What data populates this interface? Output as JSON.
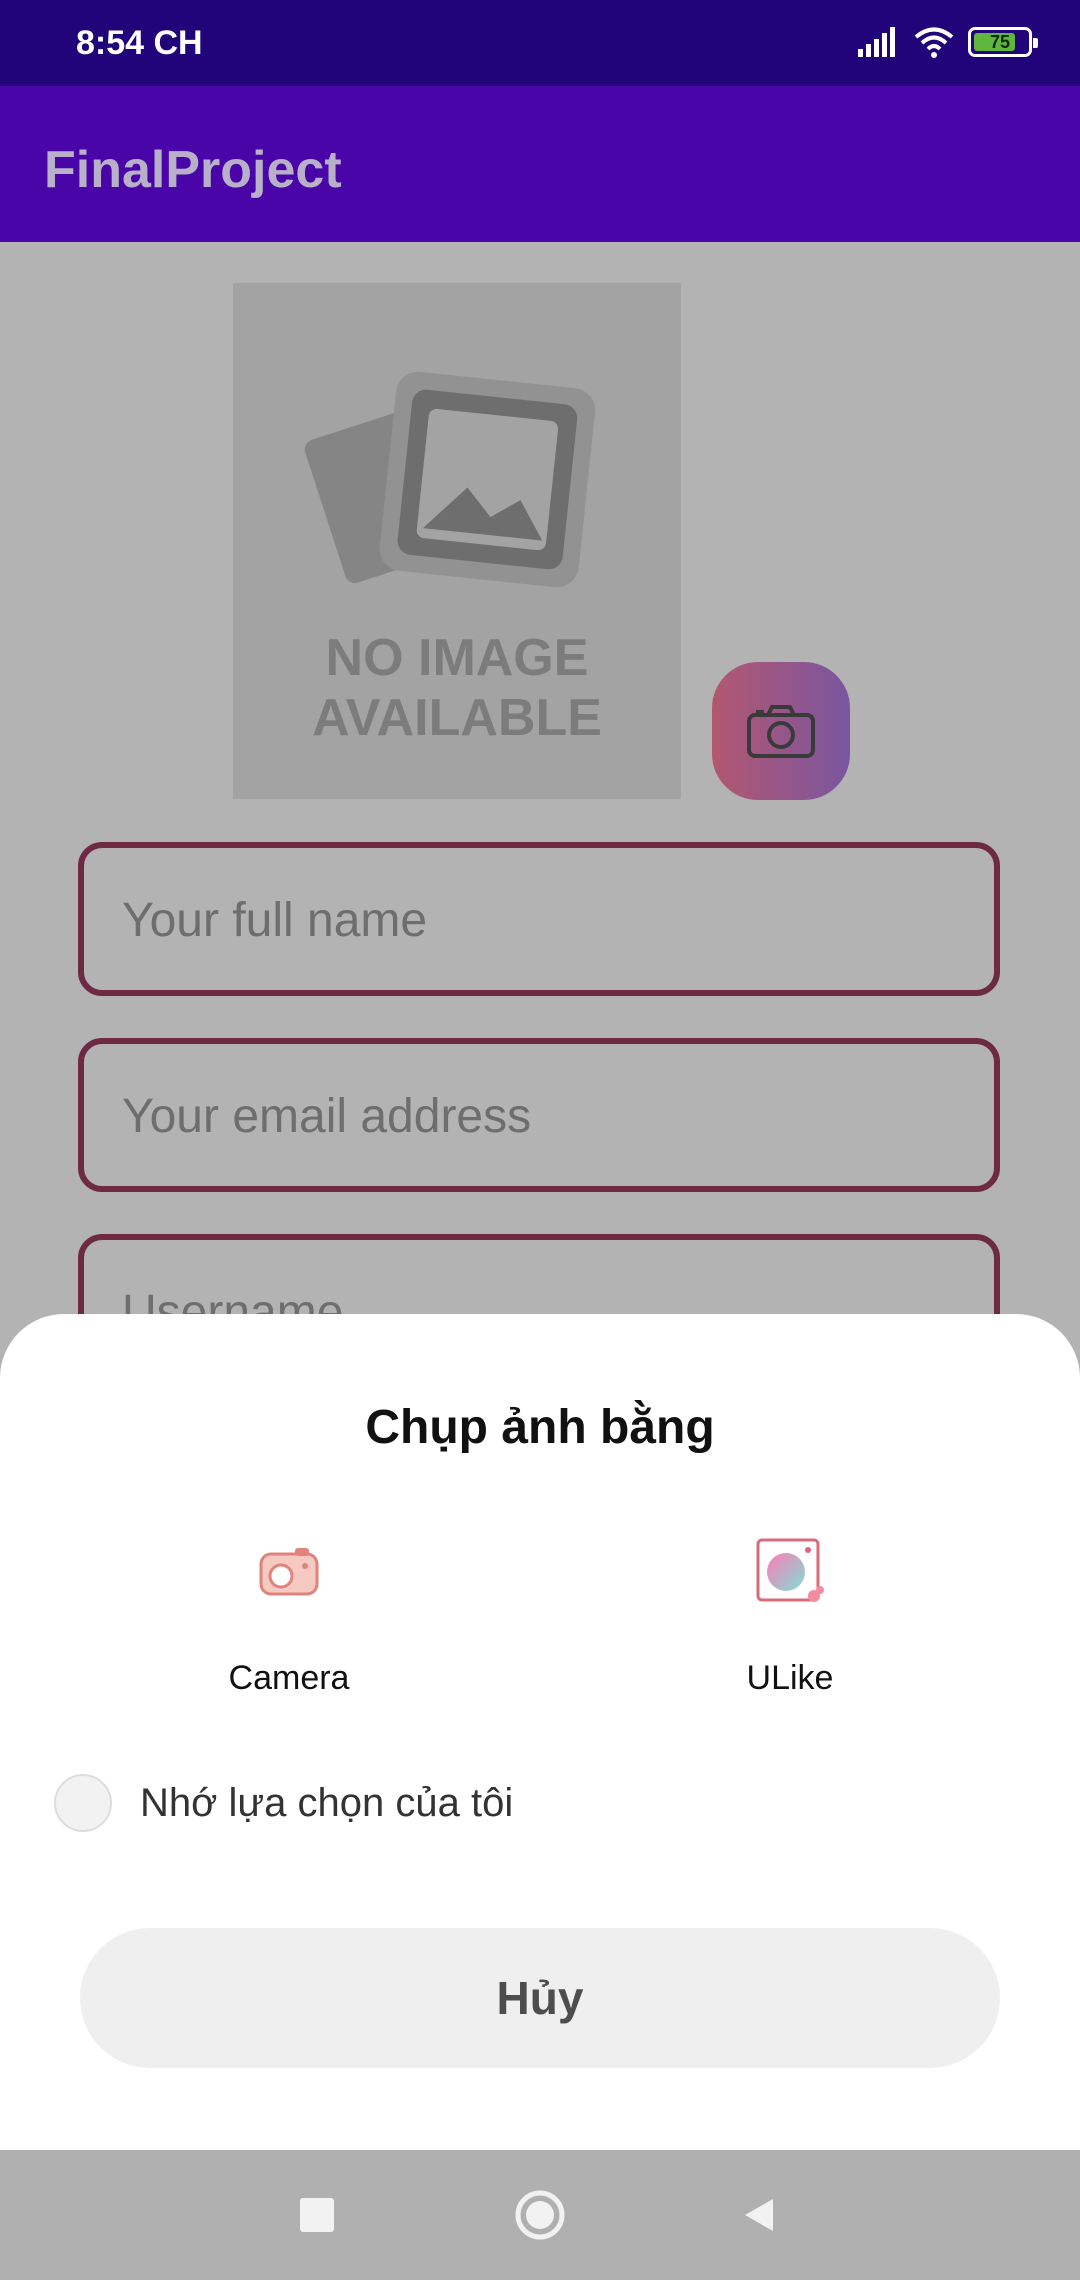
{
  "status_bar": {
    "time": "8:54 CH",
    "battery_level": "75",
    "icons": [
      "signal-icon",
      "wifi-icon",
      "battery-icon"
    ],
    "background": "#22047a"
  },
  "app_bar": {
    "title": "FinalProject",
    "background": "#4a05a8"
  },
  "profile_image": {
    "placeholder_line1": "NO IMAGE",
    "placeholder_line2": "AVAILABLE",
    "camera_button_icon": "camera-icon"
  },
  "form": {
    "full_name_placeholder": "Your full name",
    "email_placeholder": "Your email address",
    "username_placeholder": "Username",
    "border_color": "#6f2a43"
  },
  "chooser_sheet": {
    "title": "Chụp ảnh bằng",
    "apps": [
      {
        "label": "Camera",
        "icon": "camera-app-icon"
      },
      {
        "label": "ULike",
        "icon": "ulike-app-icon"
      }
    ],
    "remember_label": "Nhớ lựa chọn của tôi",
    "remember_checked": false,
    "cancel_label": "Hủy"
  },
  "navigation_bar": {
    "buttons": [
      "recents-icon",
      "home-icon",
      "back-icon"
    ]
  }
}
